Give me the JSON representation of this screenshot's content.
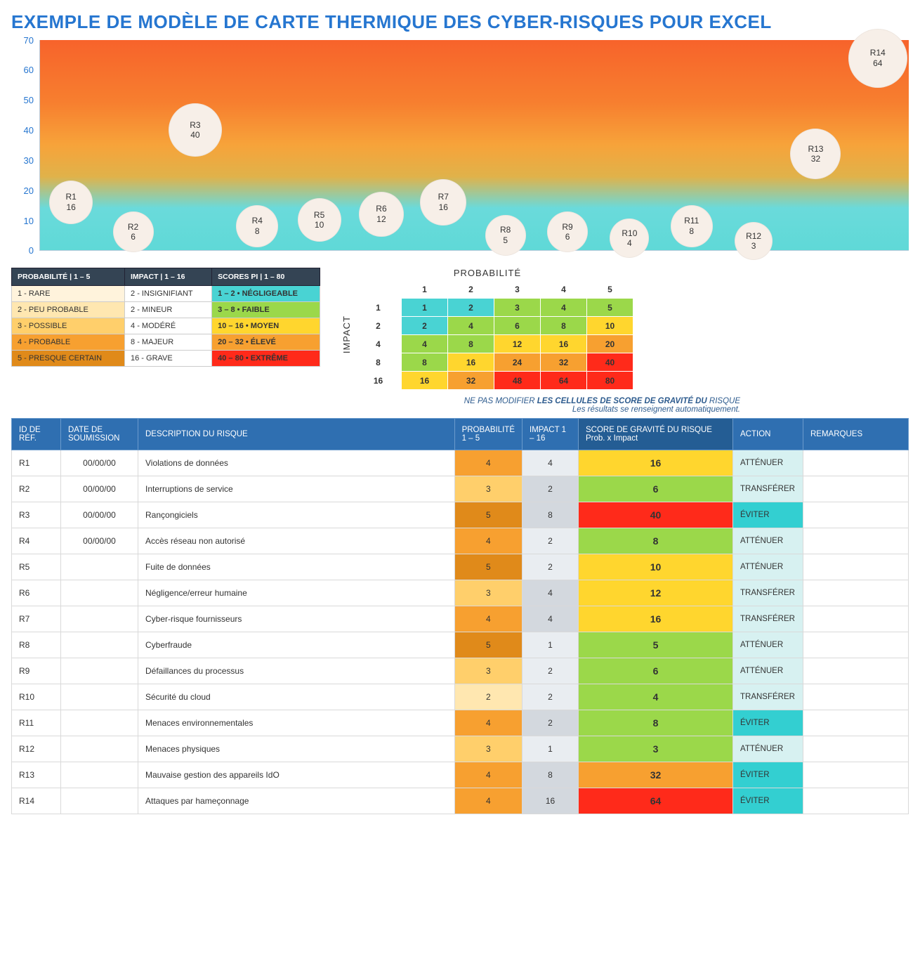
{
  "title": "EXEMPLE DE MODÈLE DE CARTE THERMIQUE DES CYBER-RISQUES POUR EXCEL",
  "chart_data": {
    "type": "bubble",
    "xlabel": "",
    "ylabel": "",
    "ylim": [
      0,
      70
    ],
    "yticks": [
      0,
      10,
      20,
      30,
      40,
      50,
      60,
      70
    ],
    "points": [
      {
        "id": "R1",
        "x": 1,
        "y": 16,
        "size": 42
      },
      {
        "id": "R2",
        "x": 2,
        "y": 6,
        "size": 38
      },
      {
        "id": "R3",
        "x": 3,
        "y": 40,
        "size": 56
      },
      {
        "id": "R4",
        "x": 4,
        "y": 8,
        "size": 40
      },
      {
        "id": "R5",
        "x": 5,
        "y": 10,
        "size": 42
      },
      {
        "id": "R6",
        "x": 6,
        "y": 12,
        "size": 44
      },
      {
        "id": "R7",
        "x": 7,
        "y": 16,
        "size": 46
      },
      {
        "id": "R8",
        "x": 8,
        "y": 5,
        "size": 38
      },
      {
        "id": "R9",
        "x": 9,
        "y": 6,
        "size": 38
      },
      {
        "id": "R10",
        "x": 10,
        "y": 4,
        "size": 36
      },
      {
        "id": "R11",
        "x": 11,
        "y": 8,
        "size": 40
      },
      {
        "id": "R12",
        "x": 12,
        "y": 3,
        "size": 34
      },
      {
        "id": "R13",
        "x": 13,
        "y": 32,
        "size": 52
      },
      {
        "id": "R14",
        "x": 14,
        "y": 64,
        "size": 64
      }
    ],
    "x_count": 14
  },
  "legend": {
    "headers": [
      "PROBABILITÉ | 1 – 5",
      "IMPACT | 1 – 16",
      "SCORES PI | 1 – 80"
    ],
    "rows": [
      {
        "prob": "1 - RARE",
        "impact": "2 - INSIGNIFIANT",
        "score": "1 – 2 • NÉGLIGEABLE",
        "probClass": "c-prob1",
        "scoreClass": "c-teal"
      },
      {
        "prob": "2 - PEU PROBABLE",
        "impact": "2 - MINEUR",
        "score": "3 – 8 • FAIBLE",
        "probClass": "c-prob2",
        "scoreClass": "c-green"
      },
      {
        "prob": "3 - POSSIBLE",
        "impact": "4 - MODÉRÉ",
        "score": "10 – 16 • MOYEN",
        "probClass": "c-prob3",
        "scoreClass": "c-yellow"
      },
      {
        "prob": "4 - PROBABLE",
        "impact": "8 - MAJEUR",
        "score": "20 – 32 • ÉLEVÉ",
        "probClass": "c-prob4",
        "scoreClass": "c-orange"
      },
      {
        "prob": "5 - PRESQUE CERTAIN",
        "impact": "16 - GRAVE",
        "score": "40 – 80 • EXTRÊME",
        "probClass": "c-prob5",
        "scoreClass": "c-red"
      }
    ]
  },
  "matrix": {
    "col_title": "PROBABILITÉ",
    "row_title": "IMPACT",
    "cols": [
      "1",
      "2",
      "3",
      "4",
      "5"
    ],
    "rows": [
      "1",
      "2",
      "4",
      "8",
      "16"
    ],
    "cells": [
      [
        {
          "v": "1",
          "c": "c-teal"
        },
        {
          "v": "2",
          "c": "c-teal"
        },
        {
          "v": "3",
          "c": "c-green"
        },
        {
          "v": "4",
          "c": "c-green"
        },
        {
          "v": "5",
          "c": "c-green"
        }
      ],
      [
        {
          "v": "2",
          "c": "c-teal"
        },
        {
          "v": "4",
          "c": "c-green"
        },
        {
          "v": "6",
          "c": "c-green"
        },
        {
          "v": "8",
          "c": "c-green"
        },
        {
          "v": "10",
          "c": "c-yellow"
        }
      ],
      [
        {
          "v": "4",
          "c": "c-green"
        },
        {
          "v": "8",
          "c": "c-green"
        },
        {
          "v": "12",
          "c": "c-yellow"
        },
        {
          "v": "16",
          "c": "c-yellow"
        },
        {
          "v": "20",
          "c": "c-orange"
        }
      ],
      [
        {
          "v": "8",
          "c": "c-green"
        },
        {
          "v": "16",
          "c": "c-yellow"
        },
        {
          "v": "24",
          "c": "c-orange"
        },
        {
          "v": "32",
          "c": "c-orange"
        },
        {
          "v": "40",
          "c": "c-red"
        }
      ],
      [
        {
          "v": "16",
          "c": "c-yellow"
        },
        {
          "v": "32",
          "c": "c-orange"
        },
        {
          "v": "48",
          "c": "c-red"
        },
        {
          "v": "64",
          "c": "c-red"
        },
        {
          "v": "80",
          "c": "c-red"
        }
      ]
    ]
  },
  "note_line1_a": "NE PAS MODIFIER ",
  "note_line1_b": "LES CELLULES DE SCORE DE GRAVITÉ DU",
  "note_line1_c": " RISQUE",
  "note_line2": "Les résultats se renseignent automatiquement.",
  "risks": {
    "headers": {
      "ref": "ID DE RÉF.",
      "date": "DATE DE SOUMISSION",
      "desc": "DESCRIPTION DU RISQUE",
      "prob": "PROBABILITÉ 1 – 5",
      "impact": "IMPACT 1 – 16",
      "score": "SCORE DE GRAVITÉ DU RISQUE Prob. x Impact",
      "action": "ACTION",
      "notes": "REMARQUES"
    },
    "rows": [
      {
        "ref": "R1",
        "date": "00/00/00",
        "desc": "Violations de données",
        "prob": 4,
        "impact": 4,
        "score": 16,
        "pClass": "c-prob4",
        "iClass": "c-imp-a",
        "sClass": "c-yellow",
        "action": "ATTÉNUER",
        "aClass": "c-act-light"
      },
      {
        "ref": "R2",
        "date": "00/00/00",
        "desc": "Interruptions de service",
        "prob": 3,
        "impact": 2,
        "score": 6,
        "pClass": "c-prob3",
        "iClass": "c-imp",
        "sClass": "c-green",
        "action": "TRANSFÉRER",
        "aClass": "c-act-light"
      },
      {
        "ref": "R3",
        "date": "00/00/00",
        "desc": "Rançongiciels",
        "prob": 5,
        "impact": 8,
        "score": 40,
        "pClass": "c-prob5",
        "iClass": "c-imp",
        "sClass": "c-red",
        "action": "ÉVITER",
        "aClass": "c-act-dark"
      },
      {
        "ref": "R4",
        "date": "00/00/00",
        "desc": "Accès réseau non autorisé",
        "prob": 4,
        "impact": 2,
        "score": 8,
        "pClass": "c-prob4",
        "iClass": "c-imp-a",
        "sClass": "c-green",
        "action": "ATTÉNUER",
        "aClass": "c-act-light"
      },
      {
        "ref": "R5",
        "date": "",
        "desc": "Fuite de données",
        "prob": 5,
        "impact": 2,
        "score": 10,
        "pClass": "c-prob5",
        "iClass": "c-imp-a",
        "sClass": "c-yellow",
        "action": "ATTÉNUER",
        "aClass": "c-act-light"
      },
      {
        "ref": "R6",
        "date": "",
        "desc": "Négligence/erreur humaine",
        "prob": 3,
        "impact": 4,
        "score": 12,
        "pClass": "c-prob3",
        "iClass": "c-imp",
        "sClass": "c-yellow",
        "action": "TRANSFÉRER",
        "aClass": "c-act-light"
      },
      {
        "ref": "R7",
        "date": "",
        "desc": "Cyber-risque fournisseurs",
        "prob": 4,
        "impact": 4,
        "score": 16,
        "pClass": "c-prob4",
        "iClass": "c-imp",
        "sClass": "c-yellow",
        "action": "TRANSFÉRER",
        "aClass": "c-act-light"
      },
      {
        "ref": "R8",
        "date": "",
        "desc": "Cyberfraude",
        "prob": 5,
        "impact": 1,
        "score": 5,
        "pClass": "c-prob5",
        "iClass": "c-imp-a",
        "sClass": "c-green",
        "action": "ATTÉNUER",
        "aClass": "c-act-light"
      },
      {
        "ref": "R9",
        "date": "",
        "desc": "Défaillances du processus",
        "prob": 3,
        "impact": 2,
        "score": 6,
        "pClass": "c-prob3",
        "iClass": "c-imp-a",
        "sClass": "c-green",
        "action": "ATTÉNUER",
        "aClass": "c-act-light"
      },
      {
        "ref": "R10",
        "date": "",
        "desc": "Sécurité du cloud",
        "prob": 2,
        "impact": 2,
        "score": 4,
        "pClass": "c-prob2",
        "iClass": "c-imp-a",
        "sClass": "c-green",
        "action": "TRANSFÉRER",
        "aClass": "c-act-light"
      },
      {
        "ref": "R11",
        "date": "",
        "desc": "Menaces environnementales",
        "prob": 4,
        "impact": 2,
        "score": 8,
        "pClass": "c-prob4",
        "iClass": "c-imp",
        "sClass": "c-green",
        "action": "ÉVITER",
        "aClass": "c-act-dark"
      },
      {
        "ref": "R12",
        "date": "",
        "desc": "Menaces physiques",
        "prob": 3,
        "impact": 1,
        "score": 3,
        "pClass": "c-prob3",
        "iClass": "c-imp-a",
        "sClass": "c-green",
        "action": "ATTÉNUER",
        "aClass": "c-act-light"
      },
      {
        "ref": "R13",
        "date": "",
        "desc": "Mauvaise gestion des appareils IdO",
        "prob": 4,
        "impact": 8,
        "score": 32,
        "pClass": "c-prob4",
        "iClass": "c-imp",
        "sClass": "c-orange",
        "action": "ÉVITER",
        "aClass": "c-act-dark"
      },
      {
        "ref": "R14",
        "date": "",
        "desc": "Attaques par hameçonnage",
        "prob": 4,
        "impact": 16,
        "score": 64,
        "pClass": "c-prob4",
        "iClass": "c-imp",
        "sClass": "c-red",
        "action": "ÉVITER",
        "aClass": "c-act-dark"
      }
    ]
  }
}
